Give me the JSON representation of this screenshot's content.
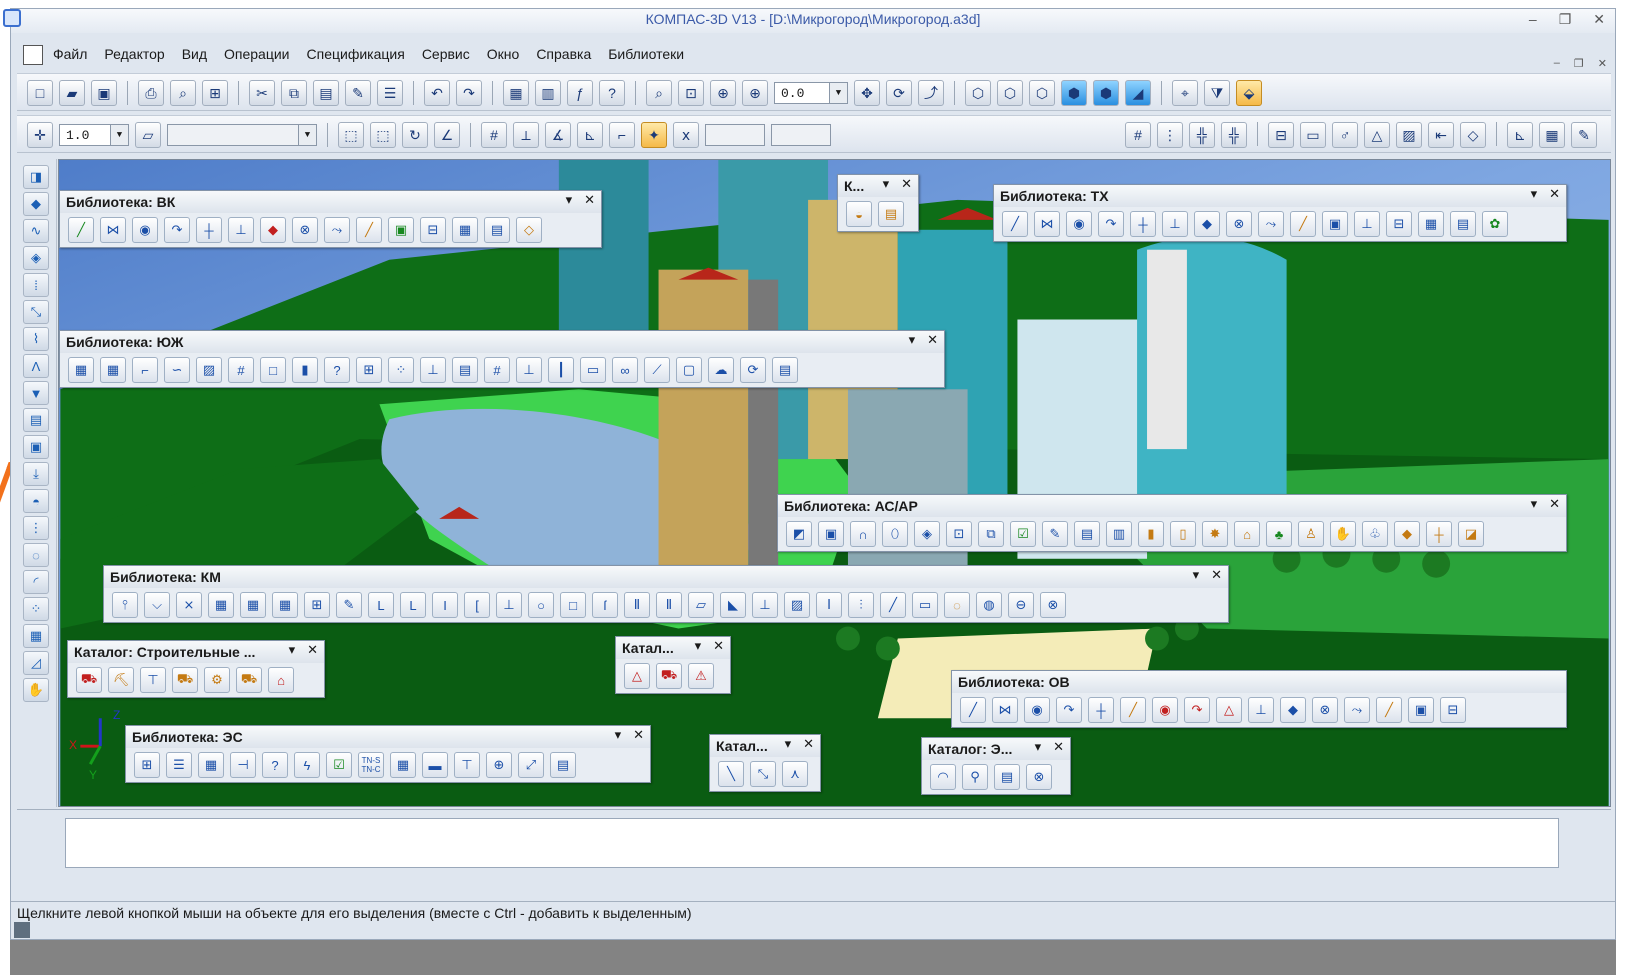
{
  "window": {
    "title": "КОМПАС-3D V13 - [D:\\Микрогород\\Микрогород.a3d]",
    "controls": [
      "–",
      "❐",
      "✕"
    ]
  },
  "menu": {
    "items": [
      "Файл",
      "Редактор",
      "Вид",
      "Операции",
      "Спецификация",
      "Сервис",
      "Окно",
      "Справка",
      "Библиотеки"
    ],
    "mdi_controls": [
      "–",
      "❐",
      "✕"
    ]
  },
  "toolbar": {
    "zoom_value": "0.0",
    "step_value": "1.0",
    "row1_icons": [
      "new-file-icon",
      "open-icon",
      "save-icon",
      "print-icon",
      "preview-icon",
      "insert-icon",
      "cut-icon",
      "copy-icon",
      "paste-icon",
      "format-icon",
      "properties-icon",
      "undo-icon",
      "redo-icon",
      "manager-icon",
      "library-manager-icon",
      "fx-icon",
      "help-pointer-icon"
    ],
    "row1_right_icons": [
      "zoom-fit-icon",
      "zoom-window-icon",
      "zoom-scale-icon",
      "zoom-in-icon",
      "pan-icon",
      "rotate-icon",
      "orientation-icon",
      "wireframe-icon",
      "hidden-lines-icon",
      "hidden-thin-icon",
      "shaded-icon",
      "shaded-edges-icon",
      "perspective-icon",
      "snap-icon",
      "filter-icon",
      "view-manager-icon"
    ],
    "row2_right_icons": [
      "grid-icon",
      "grid-align-icon",
      "axis-icon",
      "axis-plus-icon",
      "tolerance-icon",
      "roughness-icon",
      "datum-icon",
      "leader-icon",
      "hatch-icon",
      "arrow-icon",
      "position-icon",
      "coordinate-icon",
      "table-icon",
      "edit-icon"
    ]
  },
  "left_toolbar": {
    "icons": [
      "part-icon",
      "solid-icon",
      "curve-icon",
      "surface-icon",
      "array-icon",
      "measure-icon",
      "filter-icon",
      "sketch-icon",
      "funnel-icon",
      "report-icon",
      "window-icon",
      "spec-icon",
      "library-icon",
      "dots-icon",
      "circle-icon",
      "arc-icon",
      "pattern-icon",
      "table-icon",
      "plane-icon",
      "hand-icon"
    ]
  },
  "panels": {
    "vk": {
      "title": "Библиотека: ВК",
      "icons": 15
    },
    "k": {
      "title": "К..."
    },
    "tx": {
      "title": "Библиотека: ТХ",
      "icons": 16
    },
    "yuzh": {
      "title": "Библиотека: ЮЖ",
      "icons": 24
    },
    "as_ar": {
      "title": "Библиотека: АС/АР",
      "icons": 22
    },
    "km": {
      "title": "Библиотека: КМ",
      "icons": 30
    },
    "stroit": {
      "title": "Каталог: Строительные ..."
    },
    "katal1": {
      "title": "Катал..."
    },
    "katal2": {
      "title": "Катал..."
    },
    "ov": {
      "title": "Библиотека: ОВ",
      "icons": 16
    },
    "es": {
      "title": "Библиотека: ЭС",
      "tn_label": "TN-S\nTN-C"
    },
    "katalog_e": {
      "title": "Каталог: Э..."
    }
  },
  "axes": {
    "x": "X",
    "y": "Y",
    "z": "Z"
  },
  "status": {
    "text": "Щелкните левой кнопкой мыши на объекте для его выделения (вместе с Ctrl - добавить к выделенным)"
  },
  "colors": {
    "accent": "#3b5aa8",
    "ground": "#0e6e17",
    "lawn": "#2aa33a",
    "water": "#8fb3d8",
    "sky": "#4f7dc9"
  }
}
